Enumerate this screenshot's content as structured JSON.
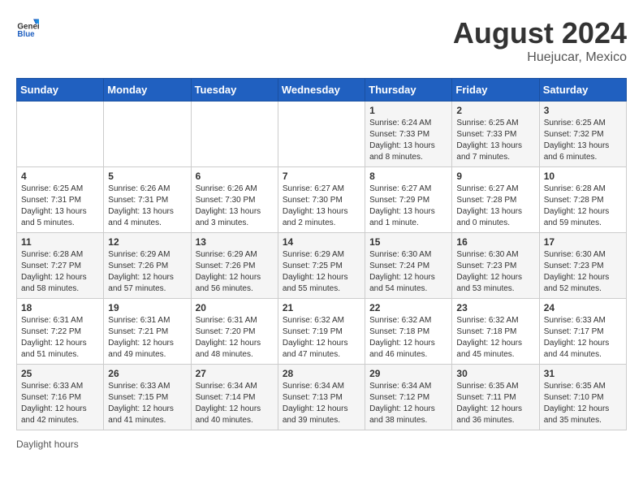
{
  "header": {
    "logo_general": "General",
    "logo_blue": "Blue",
    "month_year": "August 2024",
    "location": "Huejucar, Mexico"
  },
  "footer": {
    "daylight_hours": "Daylight hours"
  },
  "weekdays": [
    "Sunday",
    "Monday",
    "Tuesday",
    "Wednesday",
    "Thursday",
    "Friday",
    "Saturday"
  ],
  "weeks": [
    [
      {
        "day": "",
        "info": ""
      },
      {
        "day": "",
        "info": ""
      },
      {
        "day": "",
        "info": ""
      },
      {
        "day": "",
        "info": ""
      },
      {
        "day": "1",
        "info": "Sunrise: 6:24 AM\nSunset: 7:33 PM\nDaylight: 13 hours\nand 8 minutes."
      },
      {
        "day": "2",
        "info": "Sunrise: 6:25 AM\nSunset: 7:33 PM\nDaylight: 13 hours\nand 7 minutes."
      },
      {
        "day": "3",
        "info": "Sunrise: 6:25 AM\nSunset: 7:32 PM\nDaylight: 13 hours\nand 6 minutes."
      }
    ],
    [
      {
        "day": "4",
        "info": "Sunrise: 6:25 AM\nSunset: 7:31 PM\nDaylight: 13 hours\nand 5 minutes."
      },
      {
        "day": "5",
        "info": "Sunrise: 6:26 AM\nSunset: 7:31 PM\nDaylight: 13 hours\nand 4 minutes."
      },
      {
        "day": "6",
        "info": "Sunrise: 6:26 AM\nSunset: 7:30 PM\nDaylight: 13 hours\nand 3 minutes."
      },
      {
        "day": "7",
        "info": "Sunrise: 6:27 AM\nSunset: 7:30 PM\nDaylight: 13 hours\nand 2 minutes."
      },
      {
        "day": "8",
        "info": "Sunrise: 6:27 AM\nSunset: 7:29 PM\nDaylight: 13 hours\nand 1 minute."
      },
      {
        "day": "9",
        "info": "Sunrise: 6:27 AM\nSunset: 7:28 PM\nDaylight: 13 hours\nand 0 minutes."
      },
      {
        "day": "10",
        "info": "Sunrise: 6:28 AM\nSunset: 7:28 PM\nDaylight: 12 hours\nand 59 minutes."
      }
    ],
    [
      {
        "day": "11",
        "info": "Sunrise: 6:28 AM\nSunset: 7:27 PM\nDaylight: 12 hours\nand 58 minutes."
      },
      {
        "day": "12",
        "info": "Sunrise: 6:29 AM\nSunset: 7:26 PM\nDaylight: 12 hours\nand 57 minutes."
      },
      {
        "day": "13",
        "info": "Sunrise: 6:29 AM\nSunset: 7:26 PM\nDaylight: 12 hours\nand 56 minutes."
      },
      {
        "day": "14",
        "info": "Sunrise: 6:29 AM\nSunset: 7:25 PM\nDaylight: 12 hours\nand 55 minutes."
      },
      {
        "day": "15",
        "info": "Sunrise: 6:30 AM\nSunset: 7:24 PM\nDaylight: 12 hours\nand 54 minutes."
      },
      {
        "day": "16",
        "info": "Sunrise: 6:30 AM\nSunset: 7:23 PM\nDaylight: 12 hours\nand 53 minutes."
      },
      {
        "day": "17",
        "info": "Sunrise: 6:30 AM\nSunset: 7:23 PM\nDaylight: 12 hours\nand 52 minutes."
      }
    ],
    [
      {
        "day": "18",
        "info": "Sunrise: 6:31 AM\nSunset: 7:22 PM\nDaylight: 12 hours\nand 51 minutes."
      },
      {
        "day": "19",
        "info": "Sunrise: 6:31 AM\nSunset: 7:21 PM\nDaylight: 12 hours\nand 49 minutes."
      },
      {
        "day": "20",
        "info": "Sunrise: 6:31 AM\nSunset: 7:20 PM\nDaylight: 12 hours\nand 48 minutes."
      },
      {
        "day": "21",
        "info": "Sunrise: 6:32 AM\nSunset: 7:19 PM\nDaylight: 12 hours\nand 47 minutes."
      },
      {
        "day": "22",
        "info": "Sunrise: 6:32 AM\nSunset: 7:18 PM\nDaylight: 12 hours\nand 46 minutes."
      },
      {
        "day": "23",
        "info": "Sunrise: 6:32 AM\nSunset: 7:18 PM\nDaylight: 12 hours\nand 45 minutes."
      },
      {
        "day": "24",
        "info": "Sunrise: 6:33 AM\nSunset: 7:17 PM\nDaylight: 12 hours\nand 44 minutes."
      }
    ],
    [
      {
        "day": "25",
        "info": "Sunrise: 6:33 AM\nSunset: 7:16 PM\nDaylight: 12 hours\nand 42 minutes."
      },
      {
        "day": "26",
        "info": "Sunrise: 6:33 AM\nSunset: 7:15 PM\nDaylight: 12 hours\nand 41 minutes."
      },
      {
        "day": "27",
        "info": "Sunrise: 6:34 AM\nSunset: 7:14 PM\nDaylight: 12 hours\nand 40 minutes."
      },
      {
        "day": "28",
        "info": "Sunrise: 6:34 AM\nSunset: 7:13 PM\nDaylight: 12 hours\nand 39 minutes."
      },
      {
        "day": "29",
        "info": "Sunrise: 6:34 AM\nSunset: 7:12 PM\nDaylight: 12 hours\nand 38 minutes."
      },
      {
        "day": "30",
        "info": "Sunrise: 6:35 AM\nSunset: 7:11 PM\nDaylight: 12 hours\nand 36 minutes."
      },
      {
        "day": "31",
        "info": "Sunrise: 6:35 AM\nSunset: 7:10 PM\nDaylight: 12 hours\nand 35 minutes."
      }
    ]
  ]
}
